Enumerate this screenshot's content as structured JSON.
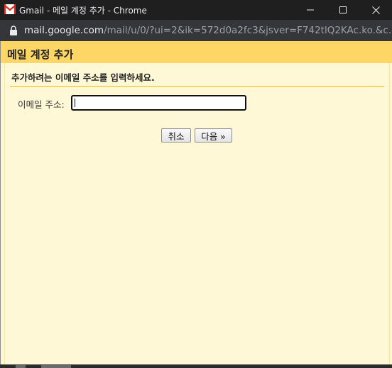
{
  "titlebar": {
    "title": "Gmail - 메일 계정 추가 - Chrome",
    "icon": "gmail-logo",
    "controls": [
      "minimize-icon",
      "maximize-icon",
      "close-icon"
    ]
  },
  "addressbar": {
    "host": "mail.google.com",
    "path": "/mail/u/0/?ui=2&ik=572d0a2fc3&jsver=F742tlQ2KAc.ko.&c...",
    "icon": "lock-icon"
  },
  "dialog": {
    "title": "메일 계정 추가",
    "instruction": "추가하려는 이메일 주소를 입력하세요.",
    "email_label": "이메일 주소:",
    "email_value": "",
    "cancel_label": "취소",
    "next_label": "다음 »"
  },
  "colors": {
    "header": "#fdd666",
    "background": "#fff8d6",
    "divider": "#f2d46b"
  }
}
